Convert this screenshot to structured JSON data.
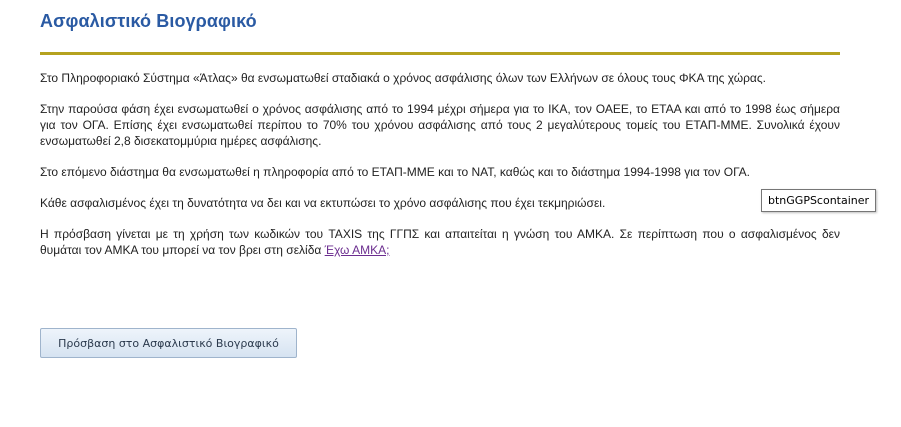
{
  "page": {
    "title": "Ασφαλιστικό Βιογραφικό"
  },
  "content": {
    "paragraph1": "Στο Πληροφοριακό Σύστημα «Άτλας» θα ενσωματωθεί σταδιακά ο χρόνος ασφάλισης όλων των Ελλήνων σε όλους τους ΦΚΑ της χώρας.",
    "paragraph2": "Στην παρούσα φάση έχει ενσωματωθεί ο χρόνος ασφάλισης από το 1994 μέχρι σήμερα για το ΙΚΑ, τον ΟΑΕΕ, το ΕΤΑΑ και από το 1998 έως σήμερα για τον ΟΓΑ. Επίσης έχει ενσωματωθεί περίπου το 70% του χρόνου ασφάλισης από τους 2 μεγαλύτερους τομείς του ΕΤΑΠ-ΜΜΕ. Συνολικά έχουν ενσωματωθεί 2,8 δισεκατομμύρια ημέρες ασφάλισης.",
    "paragraph3": "Στο επόμενο διάστημα θα ενσωματωθεί η πληροφορία από το ΕΤΑΠ-ΜΜΕ και το ΝΑΤ, καθώς και το διάστημα 1994-1998 για τον ΟΓΑ.",
    "paragraph4": "Κάθε ασφαλισμένος έχει τη δυνατότητα να δει και να εκτυπώσει το χρόνο ασφάλισης που έχει τεκμηριώσει.",
    "paragraph5_text": "Η πρόσβαση γίνεται με τη χρήση των κωδικών του TAXIS της ΓΓΠΣ και απαιτείται η γνώση του ΑΜΚΑ. Σε περίπτωση που ο ασφαλισμένος δεν θυμάται τον ΑΜΚΑ του μπορεί να τον βρει στη σελίδα ",
    "amka_link": "Έχω ΑΜΚΑ;"
  },
  "tooltip": {
    "text": "btnGGPScontainer"
  },
  "actions": {
    "access_button_label": "Πρόσβαση στο Ασφαλιστικό Βιογραφικό"
  },
  "colors": {
    "title": "#2a5aa3",
    "rule": "#b5a21f",
    "link": "#6b2d8f"
  }
}
